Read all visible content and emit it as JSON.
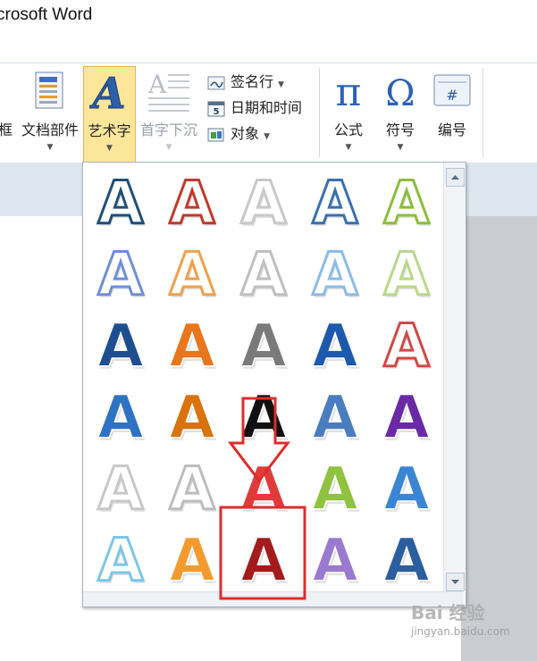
{
  "window": {
    "title": "crosoft Word"
  },
  "ribbon": {
    "buttons": [
      {
        "label": "框"
      },
      {
        "label": "文档部件"
      },
      {
        "label": "艺术字"
      },
      {
        "label": "首字下沉"
      },
      {
        "label": "公式"
      },
      {
        "label": "符号"
      },
      {
        "label": "编号"
      }
    ],
    "small_items": [
      {
        "label": "签名行"
      },
      {
        "label": "日期和时间"
      },
      {
        "label": "对象"
      }
    ],
    "number_icon_glyph": "#"
  },
  "gallery": {
    "letter": "A",
    "styles": [
      [
        "#1f4e79",
        "#c0392b",
        "#c8c8c8",
        "#3a6fb0",
        "#8cbd3b"
      ],
      [
        "#6d8fd6",
        "#f1a04a",
        "#bfbfbf",
        "#8bbbe8",
        "#b9d88a"
      ],
      [
        "#1f4e8f",
        "#e8761c",
        "#7a7a7a",
        "#1c5aad",
        "#d04848"
      ],
      [
        "#2e73c3",
        "#d9730d",
        "#111111",
        "#4a7dc0",
        "#6a2aa8"
      ],
      [
        "#c8c8c8",
        "#bdbdbd",
        "#e03a3a",
        "#8fc23e",
        "#3a86d4"
      ],
      [
        "#7cc6e8",
        "#f29a2e",
        "#a31b1b",
        "#9a7ad0",
        "#2a5e9f"
      ]
    ]
  },
  "watermark": {
    "logo": "Bai 经验",
    "url": "jingyan.baidu.com"
  }
}
